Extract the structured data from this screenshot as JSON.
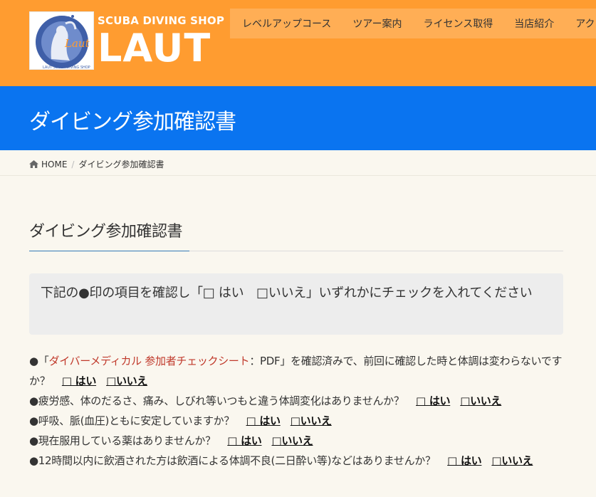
{
  "header": {
    "logo_small": "SCUBA DIVING SHOP",
    "logo_big": "LAUT",
    "emblem_script": "Laut",
    "emblem_ring": "LAUT SCUBA DIVING SHOP",
    "brand_color": "#ff9c30",
    "nav_items": [
      "レベルアップコース",
      "ツアー案内",
      "ライセンス取得",
      "当店紹介",
      "アク"
    ]
  },
  "title_band": {
    "title": "ダイビング参加確認書",
    "color": "#0a74f0"
  },
  "breadcrumb": {
    "home": "HOME",
    "current": "ダイビング参加確認書",
    "separator": "/"
  },
  "main": {
    "heading": "ダイビング参加確認書",
    "notice": "下記の●印の項目を確認し「□ はい　□いいえ」いずれかにチェックを入れてください",
    "answer_yes": "□ はい",
    "answer_no": "□いいえ",
    "items": [
      {
        "bullet": "●",
        "prefix": "「",
        "link": "ダイバーメディカル 参加者チェックシート",
        "text": "：PDF」を確認済みで、前回に確認した時と体調は変わらないですか？"
      },
      {
        "bullet": "●",
        "text": "疲労感、体のだるさ、痛み、しびれ等いつもと違う体調変化はありませんか？"
      },
      {
        "bullet": "●",
        "text": "呼吸、脈(血圧)ともに安定していますか？"
      },
      {
        "bullet": "●",
        "text": "現在服用している薬はありませんか？"
      },
      {
        "bullet": "●",
        "text": "12時間以内に飲酒された方は飲酒による体調不良(二日酔い等)などはありませんか？"
      }
    ]
  }
}
